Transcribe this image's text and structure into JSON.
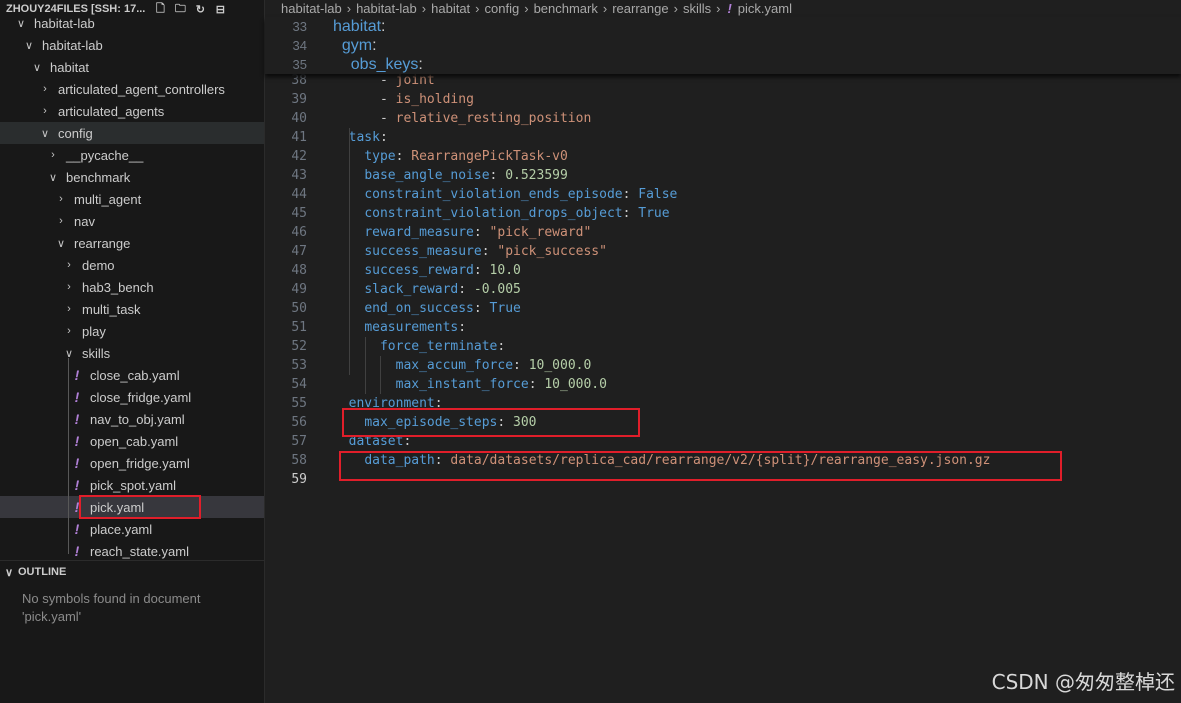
{
  "explorer": {
    "title": "ZHOUY24FILES [SSH: 17...",
    "actions": [
      "new-file-icon",
      "new-folder-icon",
      "refresh-icon",
      "collapse-icon"
    ],
    "items": [
      {
        "label": "habitat-lab",
        "depth": 0,
        "type": "folder-open"
      },
      {
        "label": "habitat-lab",
        "depth": 1,
        "type": "folder-open"
      },
      {
        "label": "habitat",
        "depth": 2,
        "type": "folder-open"
      },
      {
        "label": "articulated_agent_controllers",
        "depth": 3,
        "type": "folder"
      },
      {
        "label": "articulated_agents",
        "depth": 3,
        "type": "folder"
      },
      {
        "label": "config",
        "depth": 3,
        "type": "folder-open"
      },
      {
        "label": "__pycache__",
        "depth": 4,
        "type": "folder"
      },
      {
        "label": "benchmark",
        "depth": 4,
        "type": "folder-open"
      },
      {
        "label": "multi_agent",
        "depth": 5,
        "type": "folder"
      },
      {
        "label": "nav",
        "depth": 5,
        "type": "folder"
      },
      {
        "label": "rearrange",
        "depth": 5,
        "type": "folder-open"
      },
      {
        "label": "demo",
        "depth": 6,
        "type": "folder"
      },
      {
        "label": "hab3_bench",
        "depth": 6,
        "type": "folder"
      },
      {
        "label": "multi_task",
        "depth": 6,
        "type": "folder"
      },
      {
        "label": "play",
        "depth": 6,
        "type": "folder"
      },
      {
        "label": "skills",
        "depth": 6,
        "type": "folder-open"
      },
      {
        "label": "close_cab.yaml",
        "depth": 7,
        "type": "file"
      },
      {
        "label": "close_fridge.yaml",
        "depth": 7,
        "type": "file"
      },
      {
        "label": "nav_to_obj.yaml",
        "depth": 7,
        "type": "file"
      },
      {
        "label": "open_cab.yaml",
        "depth": 7,
        "type": "file"
      },
      {
        "label": "open_fridge.yaml",
        "depth": 7,
        "type": "file"
      },
      {
        "label": "pick_spot.yaml",
        "depth": 7,
        "type": "file"
      },
      {
        "label": "pick.yaml",
        "depth": 7,
        "type": "file"
      },
      {
        "label": "place.yaml",
        "depth": 7,
        "type": "file"
      },
      {
        "label": "reach_state.yaml",
        "depth": 7,
        "type": "file"
      }
    ]
  },
  "outline": {
    "title": "OUTLINE",
    "message": "No symbols found in document 'pick.yaml'"
  },
  "breadcrumb": [
    "habitat-lab",
    "habitat-lab",
    "habitat",
    "config",
    "benchmark",
    "rearrange",
    "skills",
    "pick.yaml"
  ],
  "sticky_lines": [
    {
      "n": "33",
      "tokens": [
        [
          "k",
          "habitat"
        ],
        [
          "p",
          ":"
        ]
      ]
    },
    {
      "n": "34",
      "tokens": [
        [
          "p",
          "  "
        ],
        [
          "k",
          "gym"
        ],
        [
          "p",
          ":"
        ]
      ]
    },
    {
      "n": "35",
      "tokens": [
        [
          "p",
          "    "
        ],
        [
          "k",
          "obs_keys"
        ],
        [
          "p",
          ":"
        ]
      ]
    }
  ],
  "code_lines": [
    {
      "n": "38",
      "tokens": [
        [
          "p",
          "      - "
        ],
        [
          "s",
          "joint"
        ]
      ]
    },
    {
      "n": "39",
      "tokens": [
        [
          "p",
          "      - "
        ],
        [
          "s",
          "is_holding"
        ]
      ]
    },
    {
      "n": "40",
      "tokens": [
        [
          "p",
          "      - "
        ],
        [
          "s",
          "relative_resting_position"
        ]
      ]
    },
    {
      "n": "41",
      "tokens": [
        [
          "p",
          "  "
        ],
        [
          "k",
          "task"
        ],
        [
          "p",
          ":"
        ]
      ]
    },
    {
      "n": "42",
      "tokens": [
        [
          "p",
          "    "
        ],
        [
          "k",
          "type"
        ],
        [
          "p",
          ": "
        ],
        [
          "s",
          "RearrangePickTask-v0"
        ]
      ]
    },
    {
      "n": "43",
      "tokens": [
        [
          "p",
          "    "
        ],
        [
          "k",
          "base_angle_noise"
        ],
        [
          "p",
          ": "
        ],
        [
          "n",
          "0.523599"
        ]
      ]
    },
    {
      "n": "44",
      "tokens": [
        [
          "p",
          "    "
        ],
        [
          "k",
          "constraint_violation_ends_episode"
        ],
        [
          "p",
          ": "
        ],
        [
          "b",
          "False"
        ]
      ]
    },
    {
      "n": "45",
      "tokens": [
        [
          "p",
          "    "
        ],
        [
          "k",
          "constraint_violation_drops_object"
        ],
        [
          "p",
          ": "
        ],
        [
          "b",
          "True"
        ]
      ]
    },
    {
      "n": "46",
      "tokens": [
        [
          "p",
          "    "
        ],
        [
          "k",
          "reward_measure"
        ],
        [
          "p",
          ": "
        ],
        [
          "s",
          "\"pick_reward\""
        ]
      ]
    },
    {
      "n": "47",
      "tokens": [
        [
          "p",
          "    "
        ],
        [
          "k",
          "success_measure"
        ],
        [
          "p",
          ": "
        ],
        [
          "s",
          "\"pick_success\""
        ]
      ]
    },
    {
      "n": "48",
      "tokens": [
        [
          "p",
          "    "
        ],
        [
          "k",
          "success_reward"
        ],
        [
          "p",
          ": "
        ],
        [
          "n",
          "10.0"
        ]
      ]
    },
    {
      "n": "49",
      "tokens": [
        [
          "p",
          "    "
        ],
        [
          "k",
          "slack_reward"
        ],
        [
          "p",
          ": "
        ],
        [
          "n",
          "-0.005"
        ]
      ]
    },
    {
      "n": "50",
      "tokens": [
        [
          "p",
          "    "
        ],
        [
          "k",
          "end_on_success"
        ],
        [
          "p",
          ": "
        ],
        [
          "b",
          "True"
        ]
      ]
    },
    {
      "n": "51",
      "tokens": [
        [
          "p",
          "    "
        ],
        [
          "k",
          "measurements"
        ],
        [
          "p",
          ":"
        ]
      ]
    },
    {
      "n": "52",
      "tokens": [
        [
          "p",
          "      "
        ],
        [
          "k",
          "force_terminate"
        ],
        [
          "p",
          ":"
        ]
      ]
    },
    {
      "n": "53",
      "tokens": [
        [
          "p",
          "        "
        ],
        [
          "k",
          "max_accum_force"
        ],
        [
          "p",
          ": "
        ],
        [
          "n",
          "10_000.0"
        ]
      ]
    },
    {
      "n": "54",
      "tokens": [
        [
          "p",
          "        "
        ],
        [
          "k",
          "max_instant_force"
        ],
        [
          "p",
          ": "
        ],
        [
          "n",
          "10_000.0"
        ]
      ]
    },
    {
      "n": "55",
      "tokens": [
        [
          "p",
          "  "
        ],
        [
          "k",
          "environment"
        ],
        [
          "p",
          ":"
        ]
      ]
    },
    {
      "n": "56",
      "tokens": [
        [
          "p",
          "    "
        ],
        [
          "k",
          "max_episode_steps"
        ],
        [
          "p",
          ": "
        ],
        [
          "n",
          "300"
        ]
      ]
    },
    {
      "n": "57",
      "tokens": [
        [
          "p",
          "  "
        ],
        [
          "k",
          "dataset"
        ],
        [
          "p",
          ":"
        ]
      ]
    },
    {
      "n": "58",
      "tokens": [
        [
          "p",
          "    "
        ],
        [
          "k",
          "data_path"
        ],
        [
          "p",
          ": "
        ],
        [
          "s",
          "data/datasets/replica_cad/rearrange/v2/{split}/rearrange_easy.json.gz"
        ]
      ]
    },
    {
      "n": "59",
      "tokens": []
    }
  ],
  "watermark": "CSDN @匆匆整棹还"
}
